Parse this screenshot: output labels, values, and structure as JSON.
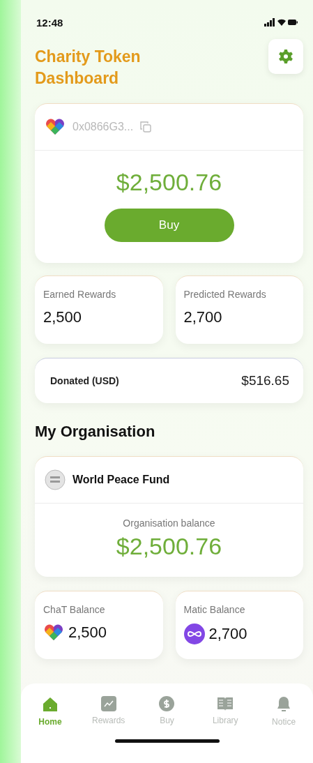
{
  "status_bar": {
    "time": "12:48"
  },
  "header": {
    "title": "Charity Token Dashboard"
  },
  "wallet": {
    "address": "0x0866G3...",
    "balance": "$2,500.76",
    "button": "Buy"
  },
  "rewards": [
    {
      "label": "Earned Rewards",
      "value": "2,500"
    },
    {
      "label": "Predicted Rewards",
      "value": "2,700"
    }
  ],
  "donated": {
    "label": "Donated (USD)",
    "value": "$516.65"
  },
  "section_title": "My Organisation",
  "organisation": {
    "name": "World Peace Fund",
    "balance_label": "Organisation balance",
    "balance": "$2,500.76"
  },
  "balances": [
    {
      "kind": "chat",
      "label": "ChaT Balance",
      "value": "2,500"
    },
    {
      "kind": "matic",
      "label": "Matic Balance",
      "value": "2,700"
    }
  ],
  "tabs": [
    {
      "kind": "home",
      "label": "Home",
      "selected": true
    },
    {
      "kind": "rewards",
      "label": "Rewards",
      "selected": false
    },
    {
      "kind": "buy",
      "label": "Buy",
      "selected": false
    },
    {
      "kind": "library",
      "label": "Library",
      "selected": false
    },
    {
      "kind": "notice",
      "label": "Notice",
      "selected": false
    }
  ]
}
